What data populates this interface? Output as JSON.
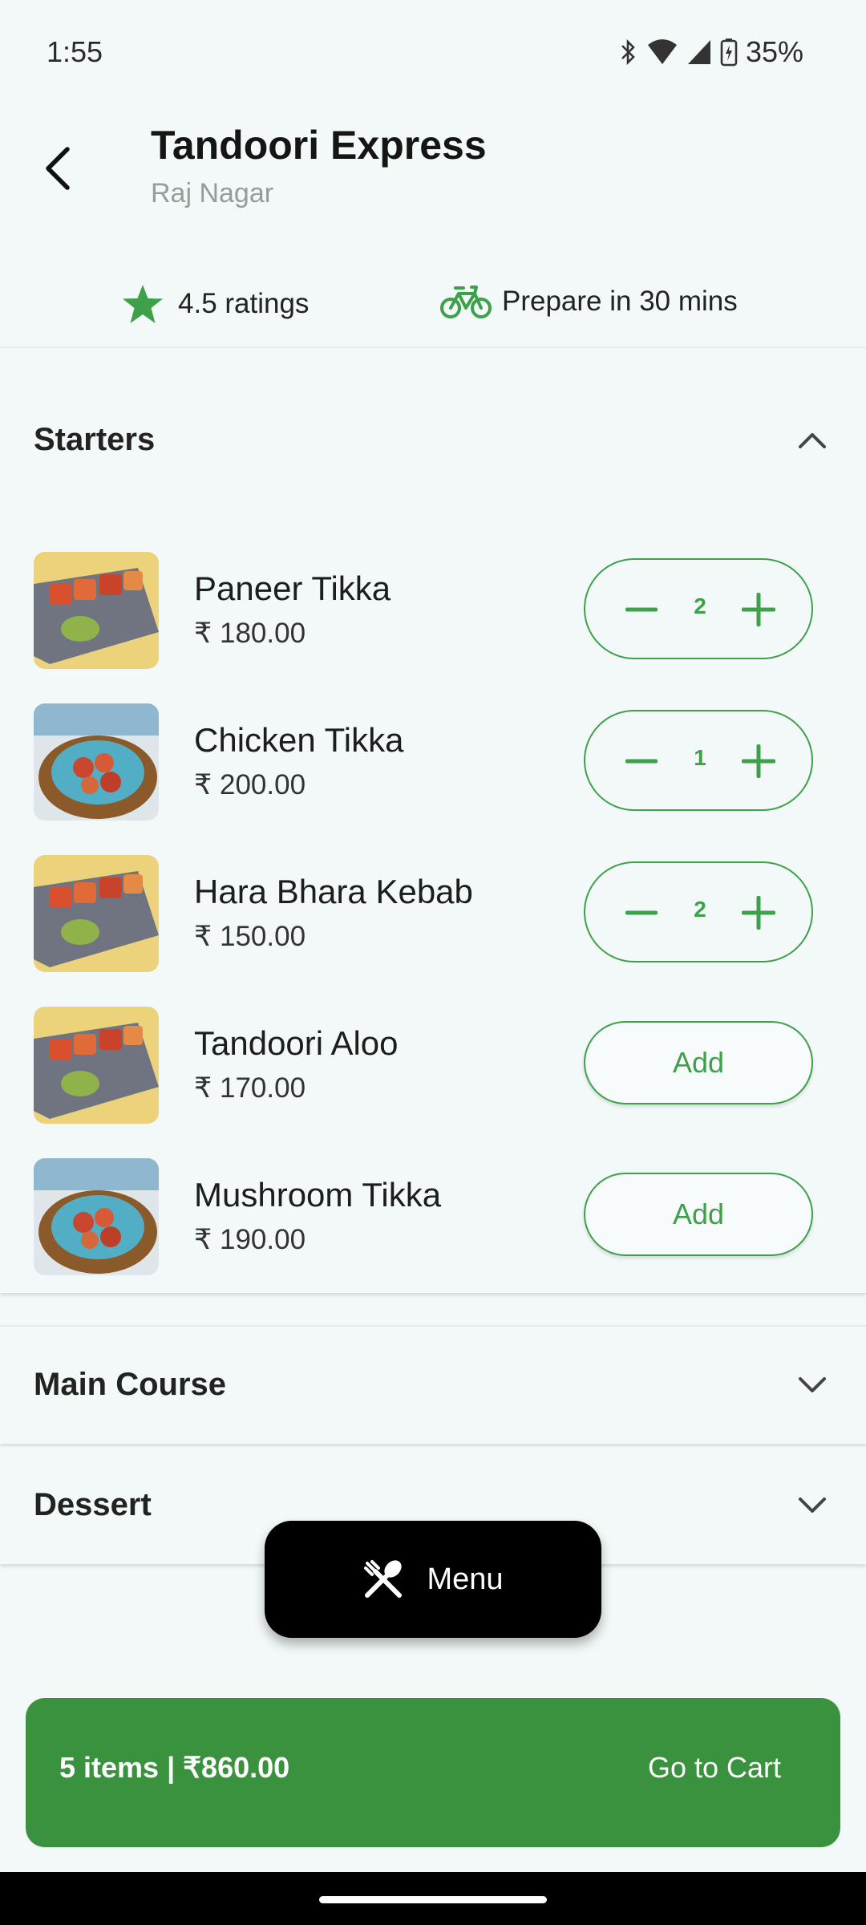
{
  "status_bar": {
    "time": "1:55",
    "battery": "35%"
  },
  "header": {
    "title": "Tandoori Express",
    "subtitle": "Raj Nagar"
  },
  "info": {
    "rating": "4.5 ratings",
    "prep": "Prepare in 30 mins"
  },
  "sections": {
    "starters": {
      "title": "Starters",
      "items": [
        {
          "name": "Paneer Tikka",
          "price": "₹ 180.00",
          "qty": "2"
        },
        {
          "name": "Chicken Tikka",
          "price": "₹ 200.00",
          "qty": "1"
        },
        {
          "name": "Hara Bhara Kebab",
          "price": "₹ 150.00",
          "qty": "2"
        },
        {
          "name": "Tandoori Aloo",
          "price": "₹ 170.00",
          "add": "Add"
        },
        {
          "name": "Mushroom Tikka",
          "price": "₹ 190.00",
          "add": "Add"
        }
      ]
    },
    "main_course": {
      "title": "Main Course"
    },
    "dessert": {
      "title": "Dessert"
    }
  },
  "menu_fab": {
    "label": "Menu"
  },
  "cart": {
    "summary": "5 items | ₹860.00",
    "action": "Go to Cart"
  },
  "colors": {
    "accent": "#3ea14a",
    "cart_bg": "#3a923f",
    "background": "#f3f9f9"
  }
}
